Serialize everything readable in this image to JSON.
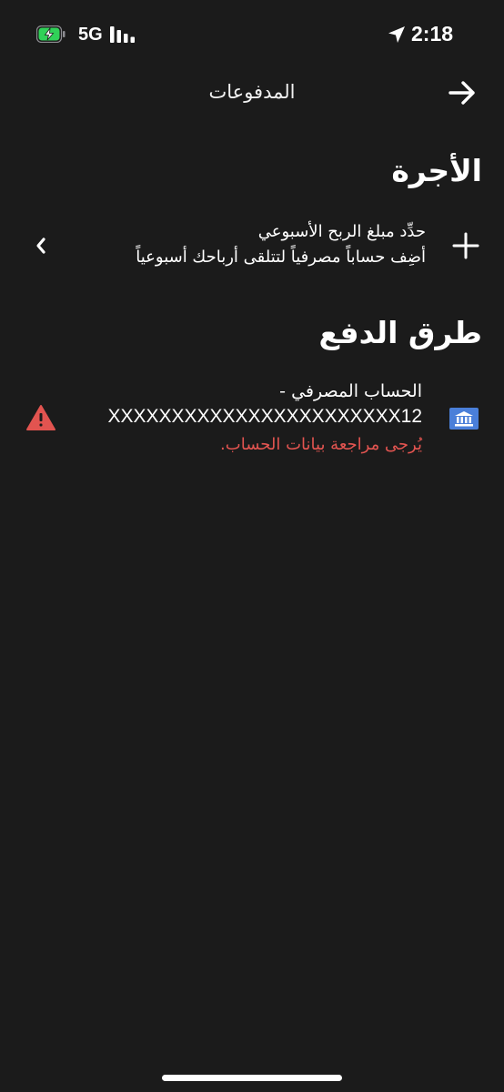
{
  "status_bar": {
    "network": "5G",
    "time": "2:18",
    "battery_color": "#30d158"
  },
  "header": {
    "title": "المدفوعات",
    "back_icon": "arrow-right-icon"
  },
  "earnings_section": {
    "title": "الأجرة",
    "weekly_item": {
      "title": "حدِّد مبلغ الربح الأسبوعي",
      "subtitle": "أضِف حساباً مصرفياً لتتلقى أرباحك أسبوعياً",
      "icon": "plus-icon"
    }
  },
  "payment_methods_section": {
    "title": "طرق الدفع",
    "bank_account": {
      "label": "الحساب المصرفي -",
      "number": "XXXXXXXXXXXXXXXXXXXXXXX12",
      "warning": "يُرجى مراجعة بيانات الحساب.",
      "warning_color": "#e25450",
      "bank_icon_color": "#4a7fd9",
      "icon": "bank-icon",
      "status_icon": "warning-triangle-icon"
    }
  }
}
